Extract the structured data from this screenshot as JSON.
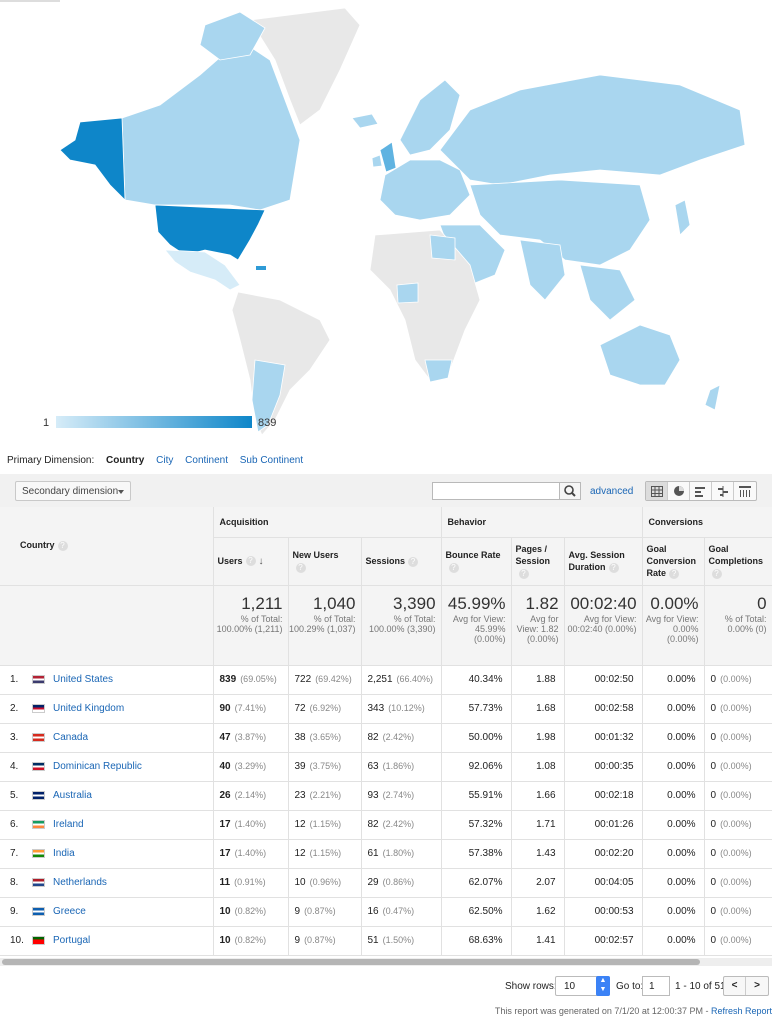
{
  "map": {
    "legend_min": "1",
    "legend_max": "839",
    "colors": {
      "low": "#d6ecf8",
      "high": "#0e86c9",
      "mid": "#a9d6ef",
      "none": "#e8e8e8"
    }
  },
  "dimension": {
    "label": "Primary Dimension:",
    "active": "Country",
    "options": [
      "City",
      "Continent",
      "Sub Continent"
    ]
  },
  "toolbar": {
    "secondary_dimension": "Secondary dimension",
    "search_value": "",
    "advanced": "advanced",
    "view_icons": [
      "grid-icon",
      "pie-icon",
      "bar-icon",
      "comparison-icon",
      "pivot-icon"
    ]
  },
  "table": {
    "country_header": "Country",
    "groups": {
      "acquisition": "Acquisition",
      "behavior": "Behavior",
      "conversions": "Conversions"
    },
    "columns": {
      "users": "Users",
      "new_users": "New Users",
      "sessions": "Sessions",
      "bounce_rate": "Bounce Rate",
      "pages_session": "Pages / Session",
      "avg_duration": "Avg. Session Duration",
      "goal_rate": "Goal Conversion Rate",
      "goal_completions": "Goal Completions"
    },
    "totals": {
      "users": "1,211",
      "users_sub": "% of Total: 100.00% (1,211)",
      "new_users": "1,040",
      "new_users_sub": "% of Total: 100.29% (1,037)",
      "sessions": "3,390",
      "sessions_sub": "% of Total: 100.00% (3,390)",
      "bounce_rate": "45.99%",
      "bounce_rate_sub": "Avg for View: 45.99% (0.00%)",
      "pages_session": "1.82",
      "pages_session_sub": "Avg for View: 1.82 (0.00%)",
      "avg_duration": "00:02:40",
      "avg_duration_sub": "Avg for View: 00:02:40 (0.00%)",
      "goal_rate": "0.00%",
      "goal_rate_sub": "Avg for View: 0.00% (0.00%)",
      "goal_completions": "0",
      "goal_completions_sub": "% of Total: 0.00% (0)"
    },
    "rows": [
      {
        "idx": "1.",
        "country": "United States",
        "users": "839",
        "users_pct": "(69.05%)",
        "new_users": "722",
        "new_users_pct": "(69.42%)",
        "sessions": "2,251",
        "sessions_pct": "(66.40%)",
        "bounce": "40.34%",
        "pages": "1.88",
        "duration": "00:02:50",
        "goal_rate": "0.00%",
        "goal": "0",
        "goal_pct": "(0.00%)"
      },
      {
        "idx": "2.",
        "country": "United Kingdom",
        "users": "90",
        "users_pct": "(7.41%)",
        "new_users": "72",
        "new_users_pct": "(6.92%)",
        "sessions": "343",
        "sessions_pct": "(10.12%)",
        "bounce": "57.73%",
        "pages": "1.68",
        "duration": "00:02:58",
        "goal_rate": "0.00%",
        "goal": "0",
        "goal_pct": "(0.00%)"
      },
      {
        "idx": "3.",
        "country": "Canada",
        "users": "47",
        "users_pct": "(3.87%)",
        "new_users": "38",
        "new_users_pct": "(3.65%)",
        "sessions": "82",
        "sessions_pct": "(2.42%)",
        "bounce": "50.00%",
        "pages": "1.98",
        "duration": "00:01:32",
        "goal_rate": "0.00%",
        "goal": "0",
        "goal_pct": "(0.00%)"
      },
      {
        "idx": "4.",
        "country": "Dominican Republic",
        "users": "40",
        "users_pct": "(3.29%)",
        "new_users": "39",
        "new_users_pct": "(3.75%)",
        "sessions": "63",
        "sessions_pct": "(1.86%)",
        "bounce": "92.06%",
        "pages": "1.08",
        "duration": "00:00:35",
        "goal_rate": "0.00%",
        "goal": "0",
        "goal_pct": "(0.00%)"
      },
      {
        "idx": "5.",
        "country": "Australia",
        "users": "26",
        "users_pct": "(2.14%)",
        "new_users": "23",
        "new_users_pct": "(2.21%)",
        "sessions": "93",
        "sessions_pct": "(2.74%)",
        "bounce": "55.91%",
        "pages": "1.66",
        "duration": "00:02:18",
        "goal_rate": "0.00%",
        "goal": "0",
        "goal_pct": "(0.00%)"
      },
      {
        "idx": "6.",
        "country": "Ireland",
        "users": "17",
        "users_pct": "(1.40%)",
        "new_users": "12",
        "new_users_pct": "(1.15%)",
        "sessions": "82",
        "sessions_pct": "(2.42%)",
        "bounce": "57.32%",
        "pages": "1.71",
        "duration": "00:01:26",
        "goal_rate": "0.00%",
        "goal": "0",
        "goal_pct": "(0.00%)"
      },
      {
        "idx": "7.",
        "country": "India",
        "users": "17",
        "users_pct": "(1.40%)",
        "new_users": "12",
        "new_users_pct": "(1.15%)",
        "sessions": "61",
        "sessions_pct": "(1.80%)",
        "bounce": "57.38%",
        "pages": "1.43",
        "duration": "00:02:20",
        "goal_rate": "0.00%",
        "goal": "0",
        "goal_pct": "(0.00%)"
      },
      {
        "idx": "8.",
        "country": "Netherlands",
        "users": "11",
        "users_pct": "(0.91%)",
        "new_users": "10",
        "new_users_pct": "(0.96%)",
        "sessions": "29",
        "sessions_pct": "(0.86%)",
        "bounce": "62.07%",
        "pages": "2.07",
        "duration": "00:04:05",
        "goal_rate": "0.00%",
        "goal": "0",
        "goal_pct": "(0.00%)"
      },
      {
        "idx": "9.",
        "country": "Greece",
        "users": "10",
        "users_pct": "(0.82%)",
        "new_users": "9",
        "new_users_pct": "(0.87%)",
        "sessions": "16",
        "sessions_pct": "(0.47%)",
        "bounce": "62.50%",
        "pages": "1.62",
        "duration": "00:00:53",
        "goal_rate": "0.00%",
        "goal": "0",
        "goal_pct": "(0.00%)"
      },
      {
        "idx": "10.",
        "country": "Portugal",
        "users": "10",
        "users_pct": "(0.82%)",
        "new_users": "9",
        "new_users_pct": "(0.87%)",
        "sessions": "51",
        "sessions_pct": "(1.50%)",
        "bounce": "68.63%",
        "pages": "1.41",
        "duration": "00:02:57",
        "goal_rate": "0.00%",
        "goal": "0",
        "goal_pct": "(0.00%)"
      }
    ]
  },
  "pager": {
    "show_rows_label": "Show rows:",
    "show_rows_value": "10",
    "goto_label": "Go to:",
    "goto_value": "1",
    "range": "1 - 10 of 51",
    "prev": "<",
    "next": ">"
  },
  "footer": {
    "text": "This report was generated on 7/1/20 at 12:00:37 PM - ",
    "refresh": "Refresh Report"
  }
}
